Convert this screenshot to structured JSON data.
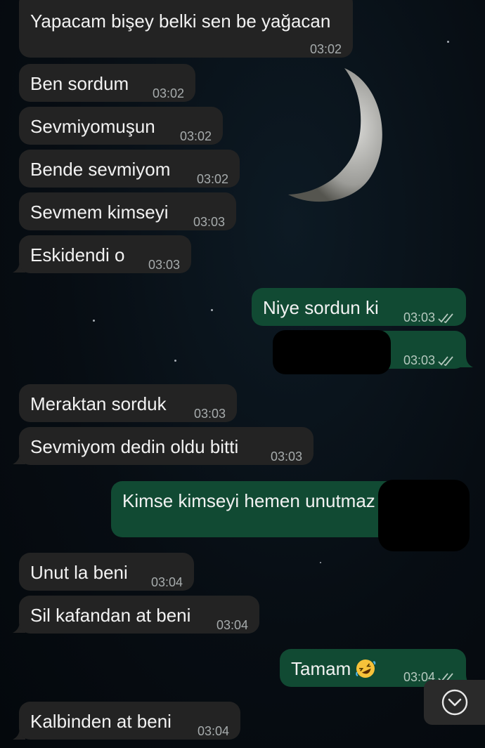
{
  "messages": [
    {
      "dir": "in",
      "text": "Yapacam bişey belki sen be yağacan",
      "time": "03:02"
    },
    {
      "dir": "in",
      "text": "Ben sordum",
      "time": "03:02"
    },
    {
      "dir": "in",
      "text": "Sevmiyomuşun",
      "time": "03:02"
    },
    {
      "dir": "in",
      "text": "Bende sevmiyom",
      "time": "03:02"
    },
    {
      "dir": "in",
      "text": "Sevmem kimseyi",
      "time": "03:03"
    },
    {
      "dir": "in",
      "text": "Eskidendi o",
      "time": "03:03"
    },
    {
      "dir": "out",
      "text": "Niye sordun ki",
      "time": "03:03",
      "status": "read"
    },
    {
      "dir": "out",
      "text": "",
      "time": "03:03",
      "status": "read",
      "redacted": true
    },
    {
      "dir": "in",
      "text": "Meraktan sorduk",
      "time": "03:03"
    },
    {
      "dir": "in",
      "text": "Sevmiyom dedin oldu bitti",
      "time": "03:03"
    },
    {
      "dir": "out",
      "text": "Kimse kimseyi hemen unutmaz",
      "time": "",
      "redacted": true
    },
    {
      "dir": "in",
      "text": "Unut la beni",
      "time": "03:04"
    },
    {
      "dir": "in",
      "text": "Sil kafandan at beni",
      "time": "03:04"
    },
    {
      "dir": "out",
      "text": "Tamam",
      "emoji": "rolling-on-floor-laughing",
      "time": "03:04",
      "status": "read"
    },
    {
      "dir": "in",
      "text": "Kalbinden at beni",
      "time": "03:04"
    }
  ],
  "icons": {
    "read_receipt": "double-check-icon",
    "scroll_down": "chevron-down-circle-icon"
  },
  "colors": {
    "incoming_bubble": "#232323",
    "outgoing_bubble": "#114a33",
    "timestamp": "#a7acad"
  }
}
